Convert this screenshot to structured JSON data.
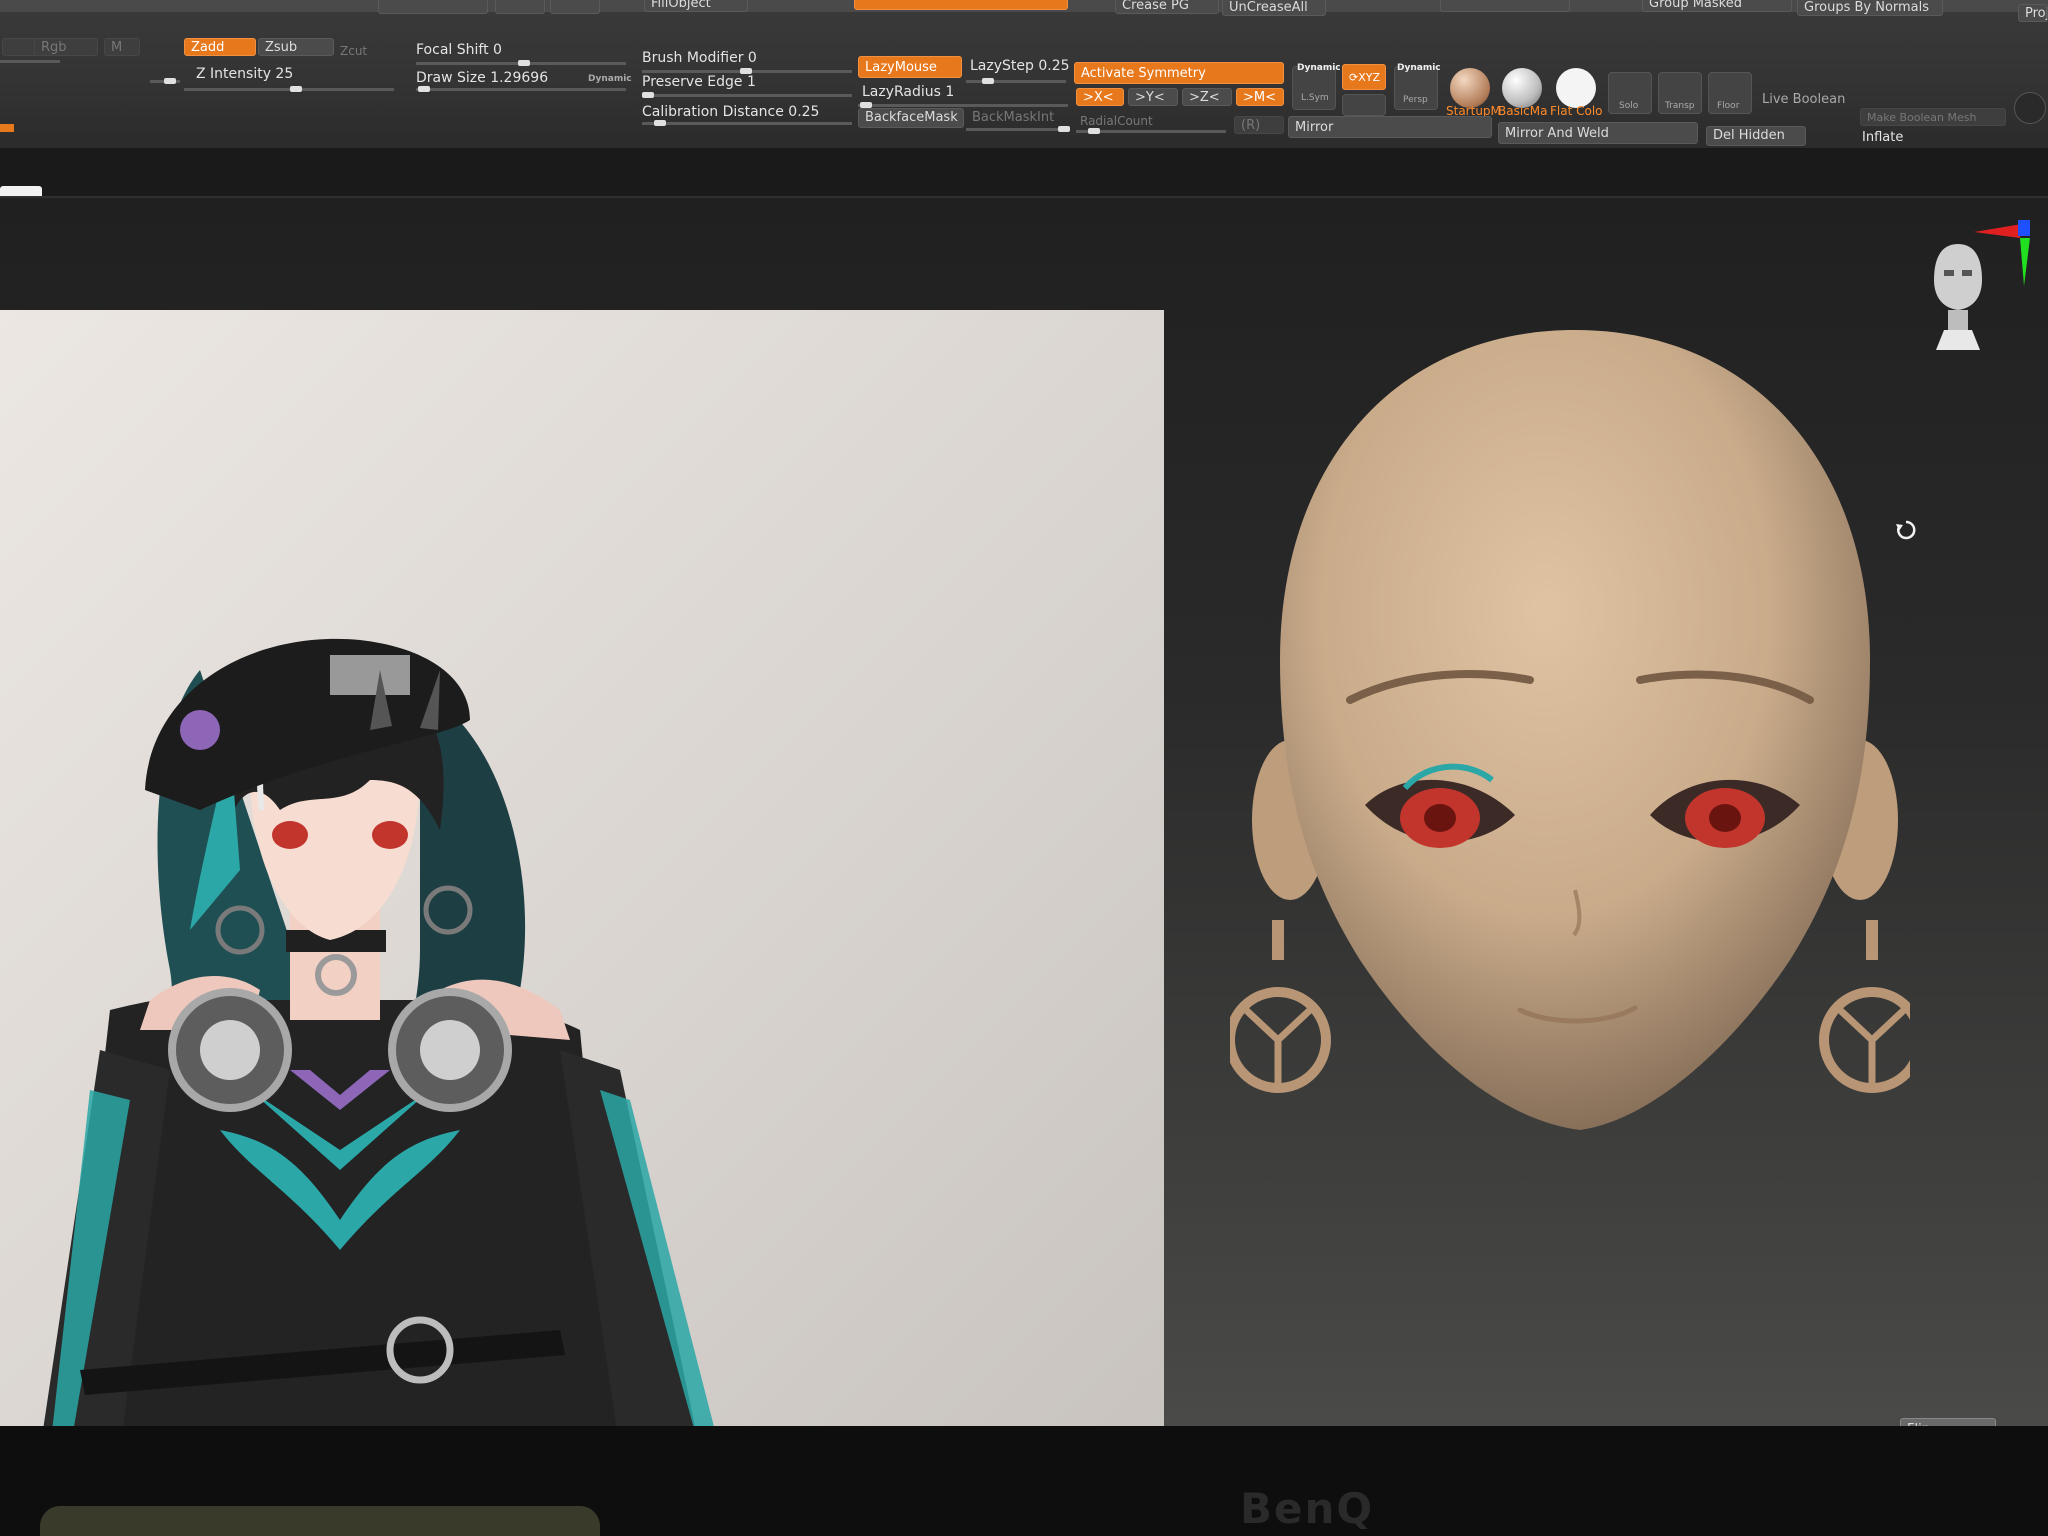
{
  "toolbar": {
    "top_buttons": [
      "FillObject",
      "Crease PG",
      "UnCreaseAll",
      "Group Masked",
      "Groups By Normals"
    ],
    "rgb": "Rgb",
    "m": "M",
    "zadd": "Zadd",
    "zsub": "Zsub",
    "zcut": "Zcut",
    "z_intensity": "Z Intensity 25",
    "focal_shift": "Focal Shift 0",
    "draw_size": "Draw Size 1.29696",
    "dynamic": "Dynamic",
    "brush_modifier": "Brush Modifier 0",
    "preserve_edge": "Preserve Edge 1",
    "calibration_distance": "Calibration Distance 0.25",
    "lazy_mouse": "LazyMouse",
    "lazy_step": "LazyStep 0.25",
    "lazy_radius": "LazyRadius 1",
    "backface_mask": "BackfaceMask",
    "backmask_int": "BackMaskInt",
    "radial_count": "RadialCount",
    "activate_symmetry": "Activate Symmetry",
    "sym_x": ">X<",
    "sym_y": ">Y<",
    "sym_z": ">Z<",
    "sym_m": ">M<",
    "sym_r": "(R)",
    "dynamic_lsym": "Dynamic",
    "lsym": "L.Sym",
    "oxyz": "⟳XYZ",
    "dynamic_persp": "Dynamic",
    "persp": "Persp",
    "material_startup": "StartupM",
    "material_basic": "BasicMa",
    "material_flat": "Flat Colo",
    "solo": "Solo",
    "transp": "Transp",
    "floor": "Floor",
    "live_boolean": "Live Boolean",
    "make_boolean_mesh": "Make Boolean Mesh",
    "mirror": "Mirror",
    "mirror_and_weld": "Mirror And Weld",
    "del_hidden": "Del Hidden",
    "inflate": "Inflate",
    "proj": "Proj"
  },
  "viewport": {
    "flip": "Flip"
  },
  "monitor": {
    "brand": "BenQ"
  },
  "colors": {
    "accent_orange": "#e8781c",
    "toolbar_bg": "#353535",
    "viewport_bg": "#262626",
    "clay": "#c9ab8a",
    "eye_red": "#c2352c",
    "hair_teal": "#2aa7a6"
  },
  "icons": [
    "brush-thumbnail-icon",
    "head-navigator-icon",
    "axis-gizmo-icon",
    "rotate-cursor-icon"
  ]
}
